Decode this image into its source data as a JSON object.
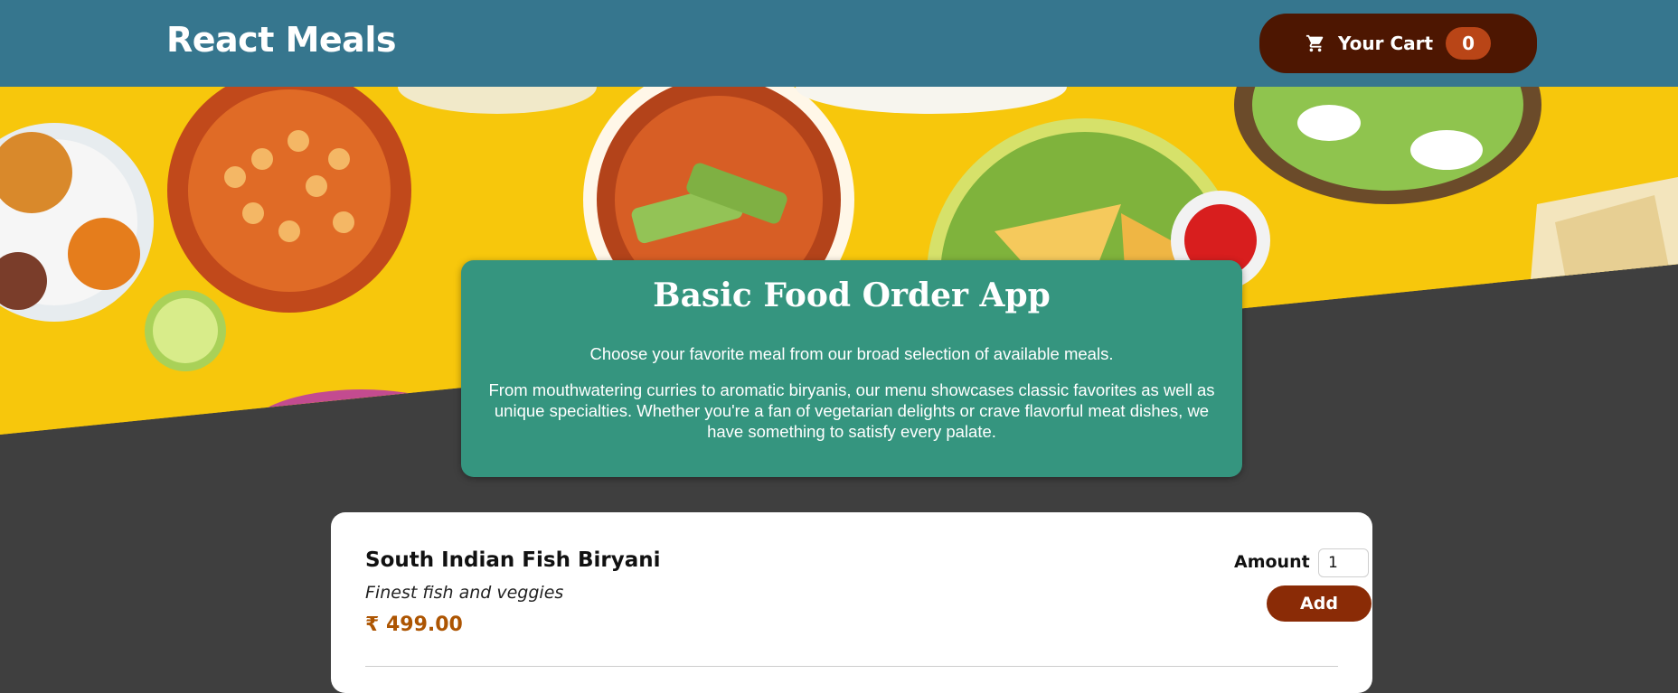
{
  "header": {
    "title": "React Meals",
    "cart": {
      "icon": "shopping-cart-icon",
      "label": "Your Cart",
      "count": "0"
    }
  },
  "summary": {
    "title": "Basic Food Order App",
    "paragraph1": "Choose your favorite meal from our broad selection of available meals.",
    "paragraph2": "From mouthwatering curries to aromatic biryanis, our menu showcases classic favorites as well as unique specialties. Whether you're a fan of vegetarian delights or crave flavorful meat dishes, we have something to satisfy every palate."
  },
  "meals": [
    {
      "name": "South Indian Fish Biryani",
      "description": "Finest fish and veggies",
      "price": "₹ 499.00",
      "amount_label": "Amount",
      "amount_value": "1",
      "add_label": "Add"
    }
  ],
  "colors": {
    "header_bg": "#36768e",
    "cart_bg": "#4d1601",
    "badge_bg": "#b94517",
    "summary_bg": "#35957f",
    "page_bg": "#3f3f3f",
    "price": "#ad5502",
    "add_button": "#8a2b06"
  }
}
